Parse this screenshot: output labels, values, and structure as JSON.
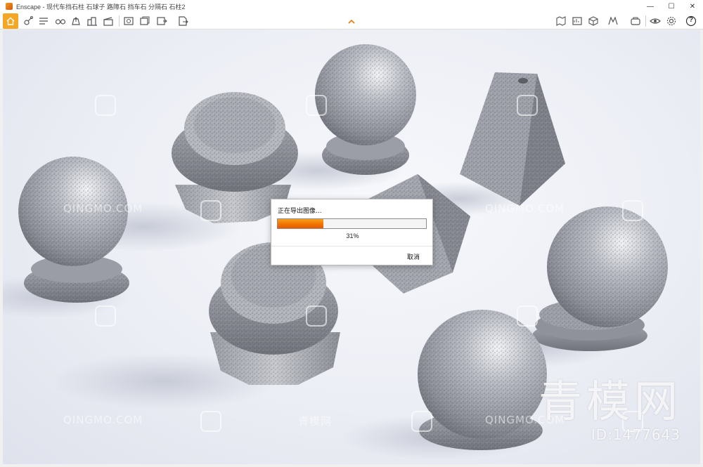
{
  "window": {
    "title": "Enscape - 现代车挡石柱 石球子 路障石 挡车石 分隔石 石柱2",
    "controls": {
      "minimize": "—",
      "maximize": "☐",
      "close": "✕"
    }
  },
  "toolbar": {
    "accent": "#f5a623",
    "left_icons": [
      "home-icon",
      "walk-icon",
      "layers-icon",
      "binoculars-icon",
      "upload-icon",
      "buildings-icon",
      "clapper-icon",
      "screenshot-icon",
      "batch-render-icon",
      "export-360-icon",
      "export-exe-icon"
    ],
    "right_icons": [
      "map-icon",
      "asset-library-icon",
      "cube-icon",
      "material-icon",
      "collaborate-icon",
      "eye-icon",
      "gear-icon",
      "help-icon"
    ],
    "help_label": "?"
  },
  "dialog": {
    "title": "正在导出图像...",
    "progress_percent": 31,
    "progress_label": "31%",
    "cancel_label": "取消",
    "fill_color": "#f07800"
  },
  "watermarks": {
    "site_text": "QINGMO.COM",
    "cn_text": "青模网",
    "big_text": "青模网",
    "id_text": "ID:1477643"
  }
}
